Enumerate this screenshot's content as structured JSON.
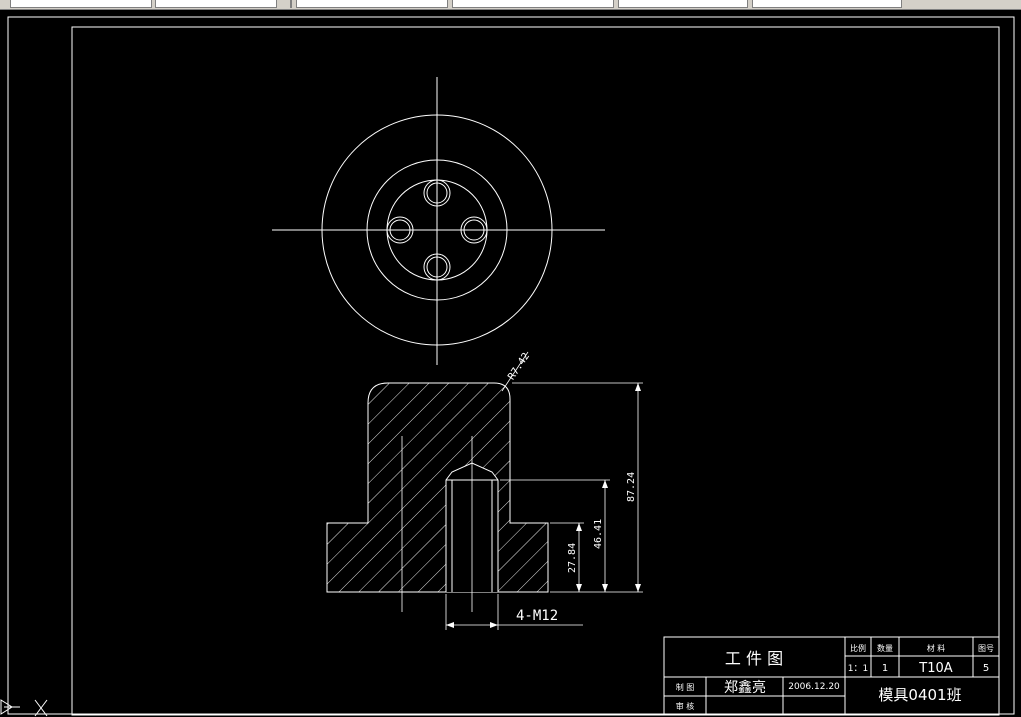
{
  "dimensions": {
    "chamfer": "R7.42",
    "total_height": "87.24",
    "bore_depth": "46.41",
    "shoulder_height": "27.84",
    "thread": "4-M12"
  },
  "title_block": {
    "title": "工 件 图",
    "scale_header": "比例",
    "quantity_header": "数量",
    "material_header": "材  料",
    "drawing_no_header": "图号",
    "scale_value": "1：1",
    "quantity_value": "1",
    "material_value": "T10A",
    "drawing_no_value": "5",
    "drawn_label": "制 图",
    "drawn_name": "郑鑫亮",
    "date": "2006.12.20",
    "checked_label": "审 核",
    "class_name": "模具0401班"
  },
  "colors": {
    "background": "#000000",
    "lines": "#ffffff",
    "toolbar": "#d4d0c8"
  },
  "icons": {
    "ucs": "ucs-icon"
  }
}
